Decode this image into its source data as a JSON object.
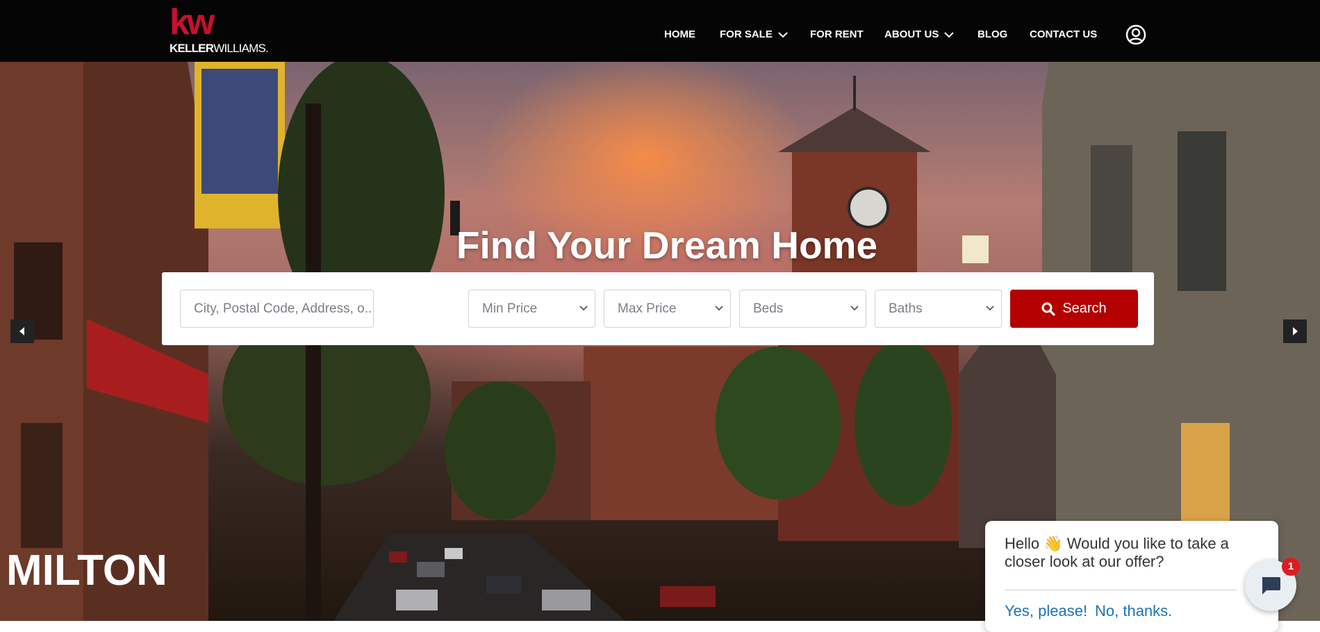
{
  "header": {
    "logo": {
      "mark": "kw",
      "name_bold": "KELLER",
      "name_light": "WILLIAMS."
    },
    "nav": [
      {
        "label": "HOME"
      },
      {
        "label": "FOR SALE",
        "dropdown": true
      },
      {
        "label": "FOR RENT"
      },
      {
        "label": "ABOUT US",
        "dropdown": true
      },
      {
        "label": "BLOG"
      },
      {
        "label": "CONTACT US"
      }
    ],
    "user_icon": "user-circle-icon"
  },
  "hero": {
    "title": "Find Your Dream Home",
    "city": "MILTON",
    "prev_icon": "caret-left-icon",
    "next_icon": "caret-right-icon"
  },
  "search": {
    "location_placeholder": "City, Postal Code, Address, o...",
    "min_price": "Min Price",
    "max_price": "Max Price",
    "beds": "Beds",
    "baths": "Baths",
    "button_label": "Search",
    "button_icon": "search-icon"
  },
  "chat": {
    "message": "Hello 👋 Would you like to take a closer look at our offer?",
    "yes": "Yes, please!",
    "no": "No, thanks.",
    "badge_count": "1",
    "bubble_icon": "chat-icon"
  },
  "colors": {
    "brand_red": "#c8102e",
    "button_red": "#b40000",
    "header_bg": "#050505",
    "link_blue": "#1a73b8"
  }
}
